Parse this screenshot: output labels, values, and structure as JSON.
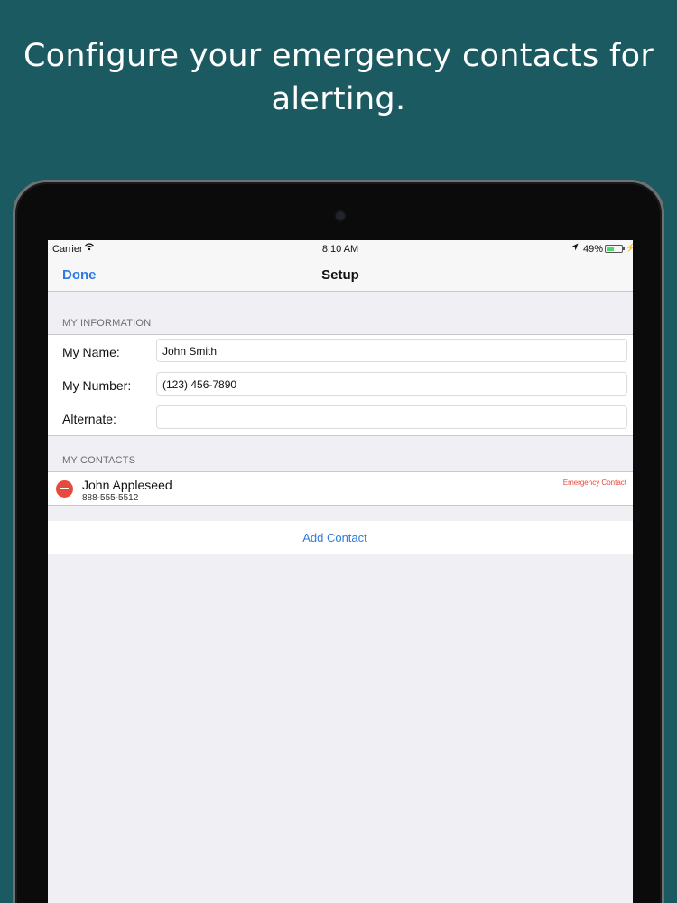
{
  "headline": "Configure your emergency contacts for alerting.",
  "status_bar": {
    "carrier": "Carrier",
    "wifi_icon": "wifi-icon",
    "time": "8:10 AM",
    "location_icon": "location-arrow-icon",
    "battery_percent": "49%",
    "battery_level": 0.49,
    "battery_color": "#4cd964"
  },
  "nav": {
    "done_label": "Done",
    "title": "Setup",
    "accent_color": "#2d7be0"
  },
  "my_information": {
    "header": "MY INFORMATION",
    "rows": [
      {
        "label": "My Name:",
        "value": "John Smith"
      },
      {
        "label": "My Number:",
        "value": "(123) 456-7890"
      },
      {
        "label": "Alternate:",
        "value": ""
      }
    ]
  },
  "my_contacts": {
    "header": "MY CONTACTS",
    "contacts": [
      {
        "name": "John Appleseed",
        "phone": "888-555-5512",
        "badge": "Emergency Contact",
        "delete_icon": "minus-circle-icon"
      }
    ],
    "add_label": "Add Contact",
    "destructive_color": "#e8493d"
  }
}
